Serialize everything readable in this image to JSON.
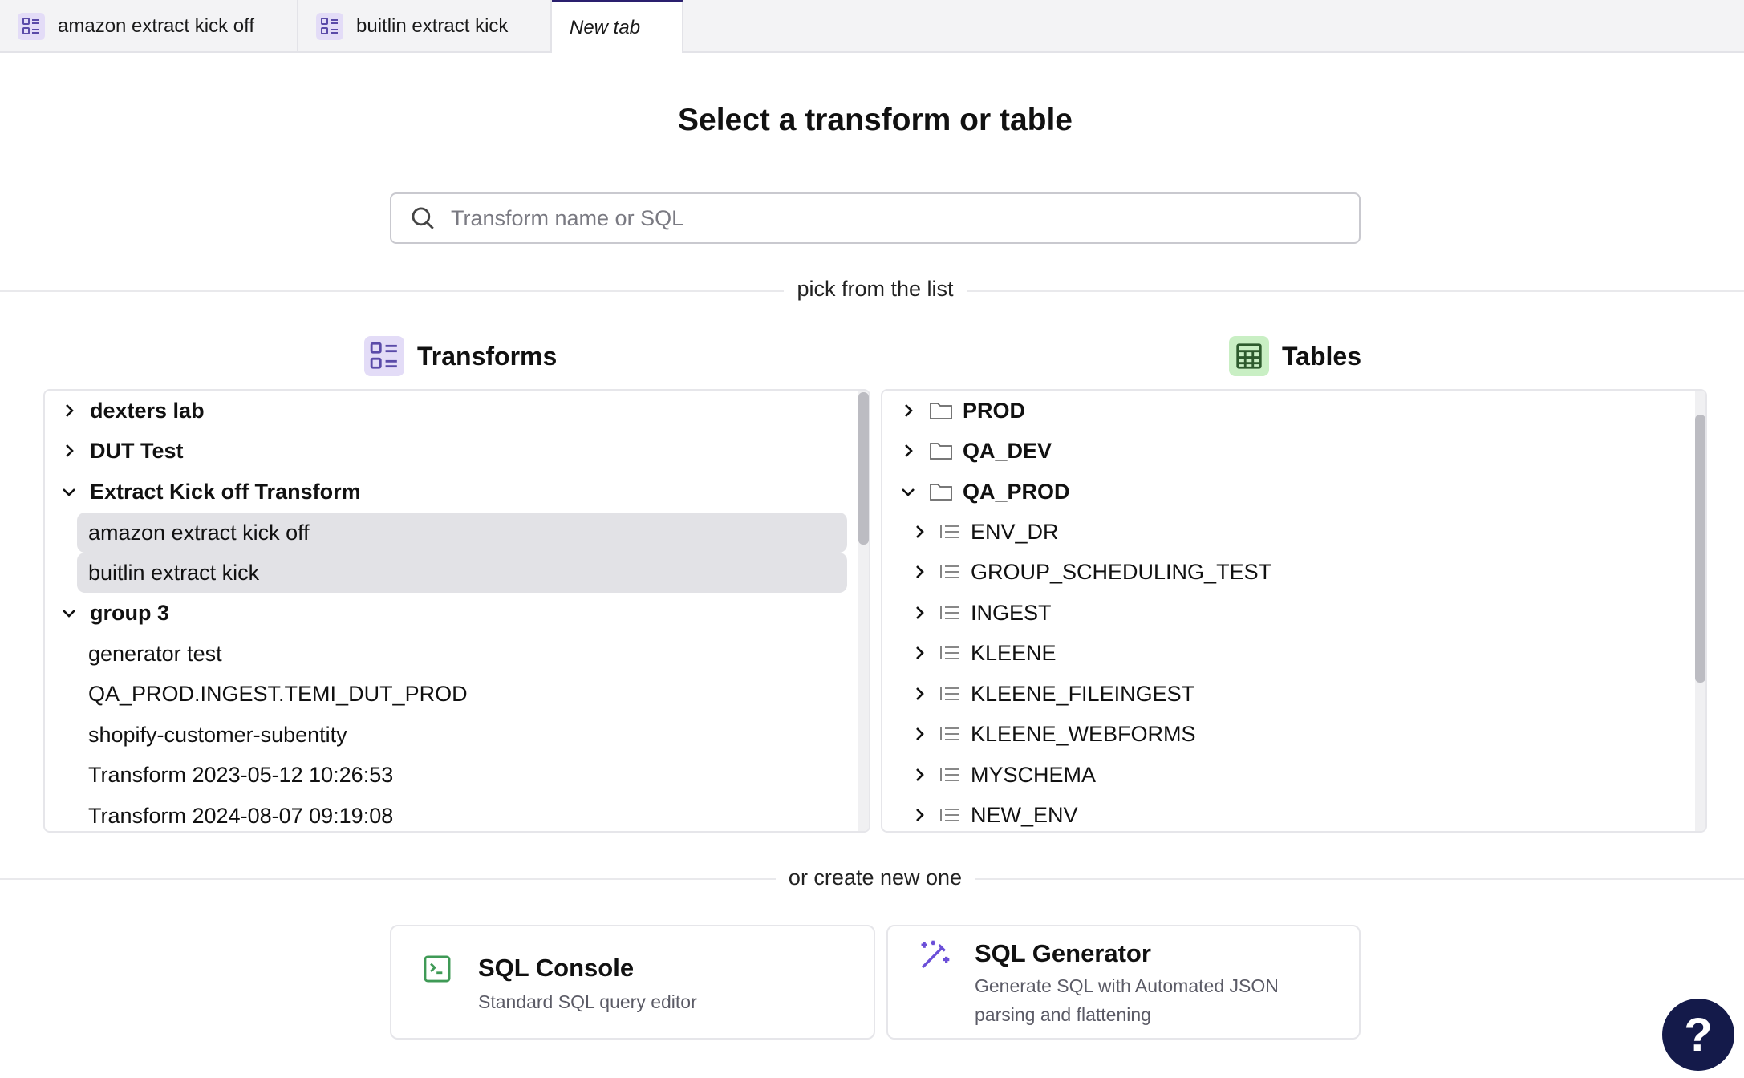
{
  "tabs": [
    {
      "label": "amazon extract kick off",
      "icon": "transform-icon"
    },
    {
      "label": "buitlin extract kick",
      "icon": "transform-icon"
    },
    {
      "label": "New tab",
      "active": true
    }
  ],
  "title": "Select a transform or table",
  "search": {
    "placeholder": "Transform name or SQL",
    "value": ""
  },
  "dividers": {
    "pick": "pick from the list",
    "create": "or create new one"
  },
  "transforms": {
    "heading": "Transforms",
    "icon": "transform-list-icon",
    "items": [
      {
        "label": "dexters lab",
        "type": "group",
        "expanded": false
      },
      {
        "label": "DUT Test",
        "type": "group",
        "expanded": false
      },
      {
        "label": "Extract Kick off Transform",
        "type": "group",
        "expanded": true
      },
      {
        "label": "amazon extract kick off",
        "type": "item",
        "selected": true
      },
      {
        "label": "buitlin extract kick",
        "type": "item",
        "selected": true
      },
      {
        "label": "group 3",
        "type": "group",
        "expanded": true
      },
      {
        "label": "generator test",
        "type": "item"
      },
      {
        "label": "QA_PROD.INGEST.TEMI_DUT_PROD",
        "type": "item"
      },
      {
        "label": "shopify-customer-subentity",
        "type": "item"
      },
      {
        "label": "Transform 2023-05-12 10:26:53",
        "type": "item"
      },
      {
        "label": "Transform 2024-08-07 09:19:08",
        "type": "item"
      }
    ]
  },
  "tables": {
    "heading": "Tables",
    "icon": "table-grid-icon",
    "items": [
      {
        "label": "PROD",
        "type": "folder",
        "expanded": false
      },
      {
        "label": "QA_DEV",
        "type": "folder",
        "expanded": false
      },
      {
        "label": "QA_PROD",
        "type": "folder",
        "expanded": true
      },
      {
        "label": "ENV_DR",
        "type": "schema"
      },
      {
        "label": "GROUP_SCHEDULING_TEST",
        "type": "schema"
      },
      {
        "label": "INGEST",
        "type": "schema"
      },
      {
        "label": "KLEENE",
        "type": "schema"
      },
      {
        "label": "KLEENE_FILEINGEST",
        "type": "schema"
      },
      {
        "label": "KLEENE_WEBFORMS",
        "type": "schema"
      },
      {
        "label": "MYSCHEMA",
        "type": "schema"
      },
      {
        "label": "NEW_ENV",
        "type": "schema"
      }
    ]
  },
  "cards": {
    "console": {
      "title": "SQL Console",
      "desc": "Standard SQL query editor",
      "icon": "terminal-icon"
    },
    "generator": {
      "title": "SQL Generator",
      "desc": "Generate SQL with Automated JSON parsing and flattening",
      "icon": "magic-wand-icon"
    }
  },
  "help": {
    "label": "?"
  },
  "colors": {
    "accent": "#2a1f6e",
    "transform_bg": "#e3dcf7",
    "table_bg": "#c9efc4",
    "console_green": "#3f9a56",
    "generator_purple": "#6b4fd8"
  }
}
